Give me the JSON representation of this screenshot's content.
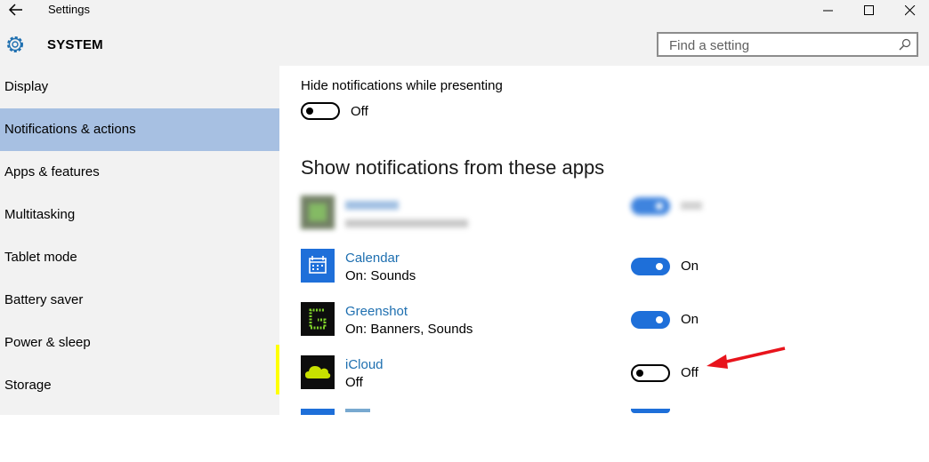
{
  "window": {
    "title": "Settings",
    "back_icon": "back-arrow-icon",
    "controls": [
      "minimize-icon",
      "maximize-icon",
      "close-icon"
    ]
  },
  "header": {
    "icon": "gear-icon",
    "title": "SYSTEM",
    "search_placeholder": "Find a setting",
    "search_icon": "search-icon"
  },
  "sidebar": {
    "active_index": 1,
    "items": [
      {
        "label": "Display"
      },
      {
        "label": "Notifications & actions"
      },
      {
        "label": "Apps & features"
      },
      {
        "label": "Multitasking"
      },
      {
        "label": "Tablet mode"
      },
      {
        "label": "Battery saver"
      },
      {
        "label": "Power & sleep"
      },
      {
        "label": "Storage"
      }
    ]
  },
  "main": {
    "hide_while_presenting": {
      "label": "Hide notifications while presenting",
      "state": "Off",
      "on": false
    },
    "apps_heading": "Show notifications from these apps",
    "apps": [
      {
        "name": "",
        "status": "",
        "state": "",
        "on": true,
        "icon": "blurred-app-icon",
        "blurred": true
      },
      {
        "name": "Calendar",
        "status": "On: Sounds",
        "state": "On",
        "on": true,
        "icon": "calendar-icon"
      },
      {
        "name": "Greenshot",
        "status": "On: Banners, Sounds",
        "state": "On",
        "on": true,
        "icon": "greenshot-icon"
      },
      {
        "name": "iCloud",
        "status": "Off",
        "state": "Off",
        "on": false,
        "icon": "icloud-icon",
        "highlighted": true
      },
      {
        "name": "",
        "status": "",
        "state": "",
        "on": true,
        "icon": "mail-icon",
        "partial": true
      }
    ]
  },
  "annotation": {
    "arrow_color": "#e8141c",
    "highlight_color": "#ffff00"
  }
}
